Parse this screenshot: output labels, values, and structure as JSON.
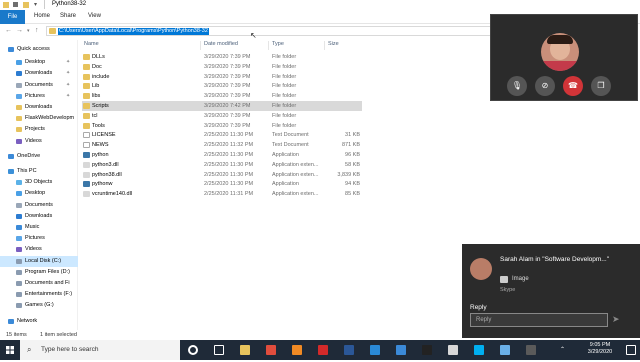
{
  "window": {
    "title": "Python38-32"
  },
  "ribbon": {
    "tabs": [
      "File",
      "Home",
      "Share",
      "View"
    ]
  },
  "address": {
    "path": "C:\\Users\\User\\AppData\\Local\\Programs\\Python\\Python38-32"
  },
  "nav": {
    "items": [
      {
        "label": "Quick access",
        "icon": "star-icon",
        "color": "#3c8ad8",
        "indent": 0,
        "pinned": false
      },
      {
        "label": "Desktop",
        "icon": "desktop-folder-icon",
        "color": "#4aa0e6",
        "indent": 1,
        "pinned": true
      },
      {
        "label": "Downloads",
        "icon": "downloads-folder-icon",
        "color": "#2c7cd1",
        "indent": 1,
        "pinned": true
      },
      {
        "label": "Documents",
        "icon": "documents-folder-icon",
        "color": "#9aa7b8",
        "indent": 1,
        "pinned": true
      },
      {
        "label": "Pictures",
        "icon": "pictures-folder-icon",
        "color": "#5aa6e8",
        "indent": 1,
        "pinned": true
      },
      {
        "label": "Downloads",
        "icon": "folder-icon",
        "color": "#e7c35d",
        "indent": 1,
        "pinned": false
      },
      {
        "label": "FlaskWebDevelopm",
        "icon": "folder-icon",
        "color": "#e7c35d",
        "indent": 1,
        "pinned": false
      },
      {
        "label": "Projects",
        "icon": "folder-icon",
        "color": "#e7c35d",
        "indent": 1,
        "pinned": false
      },
      {
        "label": "Videos",
        "icon": "videos-folder-icon",
        "color": "#7a5fc0",
        "indent": 1,
        "pinned": false
      },
      {
        "label": "OneDrive",
        "icon": "cloud-icon",
        "color": "#3c8ad8",
        "indent": 0,
        "pinned": false
      },
      {
        "label": "This PC",
        "icon": "computer-icon",
        "color": "#3b90d8",
        "indent": 0,
        "pinned": false
      },
      {
        "label": "3D Objects",
        "icon": "3d-objects-icon",
        "color": "#5bb2e8",
        "indent": 1,
        "pinned": false
      },
      {
        "label": "Desktop",
        "icon": "desktop-folder-icon",
        "color": "#4aa0e6",
        "indent": 1,
        "pinned": false
      },
      {
        "label": "Documents",
        "icon": "documents-folder-icon",
        "color": "#9aa7b8",
        "indent": 1,
        "pinned": false
      },
      {
        "label": "Downloads",
        "icon": "downloads-folder-icon",
        "color": "#2c7cd1",
        "indent": 1,
        "pinned": false
      },
      {
        "label": "Music",
        "icon": "music-folder-icon",
        "color": "#3b8ad8",
        "indent": 1,
        "pinned": false
      },
      {
        "label": "Pictures",
        "icon": "pictures-folder-icon",
        "color": "#5aa6e8",
        "indent": 1,
        "pinned": false
      },
      {
        "label": "Videos",
        "icon": "videos-folder-icon",
        "color": "#7a5fc0",
        "indent": 1,
        "pinned": false
      },
      {
        "label": "Local Disk (C:)",
        "icon": "drive-icon",
        "color": "#8a9bb0",
        "indent": 1,
        "pinned": false,
        "selected": true
      },
      {
        "label": "Program Files (D:)",
        "icon": "drive-icon",
        "color": "#8a9bb0",
        "indent": 1,
        "pinned": false
      },
      {
        "label": "Documents and Fi",
        "icon": "drive-icon",
        "color": "#8a9bb0",
        "indent": 1,
        "pinned": false
      },
      {
        "label": "Entertainments (F:)",
        "icon": "drive-icon",
        "color": "#8a9bb0",
        "indent": 1,
        "pinned": false
      },
      {
        "label": "Games (G:)",
        "icon": "drive-icon",
        "color": "#8a9bb0",
        "indent": 1,
        "pinned": false
      },
      {
        "label": "Network",
        "icon": "network-icon",
        "color": "#3b8ad8",
        "indent": 0,
        "pinned": false
      }
    ]
  },
  "columns": {
    "name": "Name",
    "date": "Date modified",
    "type": "Type",
    "size": "Size"
  },
  "files": [
    {
      "name": "DLLs",
      "date": "3/29/2020 7:39 PM",
      "type": "File folder",
      "size": "",
      "icon": "folder-icon",
      "color": "#e7c35d"
    },
    {
      "name": "Doc",
      "date": "3/29/2020 7:39 PM",
      "type": "File folder",
      "size": "",
      "icon": "folder-icon",
      "color": "#e7c35d"
    },
    {
      "name": "include",
      "date": "3/29/2020 7:39 PM",
      "type": "File folder",
      "size": "",
      "icon": "folder-icon",
      "color": "#e7c35d"
    },
    {
      "name": "Lib",
      "date": "3/29/2020 7:39 PM",
      "type": "File folder",
      "size": "",
      "icon": "folder-icon",
      "color": "#e7c35d"
    },
    {
      "name": "libs",
      "date": "3/29/2020 7:39 PM",
      "type": "File folder",
      "size": "",
      "icon": "folder-icon",
      "color": "#e7c35d"
    },
    {
      "name": "Scripts",
      "date": "3/29/2020 7:42 PM",
      "type": "File folder",
      "size": "",
      "icon": "folder-icon",
      "color": "#e7c35d",
      "selected": true
    },
    {
      "name": "tcl",
      "date": "3/29/2020 7:39 PM",
      "type": "File folder",
      "size": "",
      "icon": "folder-icon",
      "color": "#e7c35d"
    },
    {
      "name": "Tools",
      "date": "3/29/2020 7:39 PM",
      "type": "File folder",
      "size": "",
      "icon": "folder-icon",
      "color": "#e7c35d"
    },
    {
      "name": "LICENSE",
      "date": "2/25/2020 11:30 PM",
      "type": "Text Document",
      "size": "31 KB",
      "icon": "text-file-icon",
      "color": "#ffffff"
    },
    {
      "name": "NEWS",
      "date": "2/25/2020 11:32 PM",
      "type": "Text Document",
      "size": "871 KB",
      "icon": "text-file-icon",
      "color": "#ffffff"
    },
    {
      "name": "python",
      "date": "2/25/2020 11:30 PM",
      "type": "Application",
      "size": "96 KB",
      "icon": "python-icon",
      "color": "#3b77a8"
    },
    {
      "name": "python3.dll",
      "date": "2/25/2020 11:30 PM",
      "type": "Application exten...",
      "size": "58 KB",
      "icon": "dll-file-icon",
      "color": "#d8d8d8"
    },
    {
      "name": "python38.dll",
      "date": "2/25/2020 11:30 PM",
      "type": "Application exten...",
      "size": "3,839 KB",
      "icon": "dll-file-icon",
      "color": "#d8d8d8"
    },
    {
      "name": "pythonw",
      "date": "2/25/2020 11:30 PM",
      "type": "Application",
      "size": "94 KB",
      "icon": "python-icon",
      "color": "#3b77a8"
    },
    {
      "name": "vcruntime140.dll",
      "date": "2/25/2020 11:31 PM",
      "type": "Application exten...",
      "size": "85 KB",
      "icon": "dll-file-icon",
      "color": "#d8d8d8"
    }
  ],
  "status": {
    "count": "15 items",
    "selection": "1 item selected"
  },
  "taskbar": {
    "search_placeholder": "Type here to search",
    "time": "9:05 PM",
    "date": "3/29/2020",
    "apps": [
      {
        "icon": "cortana-icon",
        "color": "#ffffff"
      },
      {
        "icon": "task-view-icon",
        "color": "#ffffff"
      },
      {
        "icon": "file-explorer-icon",
        "color": "#e7c35d"
      },
      {
        "icon": "chrome-icon",
        "color": "#e14d3d"
      },
      {
        "icon": "firefox-icon",
        "color": "#f08a24"
      },
      {
        "icon": "acrobat-icon",
        "color": "#d42a2a"
      },
      {
        "icon": "word-icon",
        "color": "#2b5797"
      },
      {
        "icon": "vscode-icon",
        "color": "#2a8ad8"
      },
      {
        "icon": "media-icon",
        "color": "#3b8ad8"
      },
      {
        "icon": "terminal-icon",
        "color": "#222222"
      },
      {
        "icon": "mail-icon",
        "color": "#d8d8d8"
      },
      {
        "icon": "skype-icon",
        "color": "#00aff0"
      },
      {
        "icon": "notepad-icon",
        "color": "#6ab0e8"
      },
      {
        "icon": "calculator-icon",
        "color": "#5a5a5a"
      }
    ]
  },
  "call": {
    "buttons": [
      {
        "name": "microphone-icon",
        "red": false
      },
      {
        "name": "camera-off-icon",
        "red": false
      },
      {
        "name": "hang-up-icon",
        "red": true
      },
      {
        "name": "switch-window-icon",
        "red": false
      }
    ]
  },
  "notification": {
    "title": "Sarah Alam in \"Software Developm...\"",
    "body": "Image",
    "app": "Skype",
    "reply_label": "Reply",
    "reply_placeholder": "Reply"
  }
}
